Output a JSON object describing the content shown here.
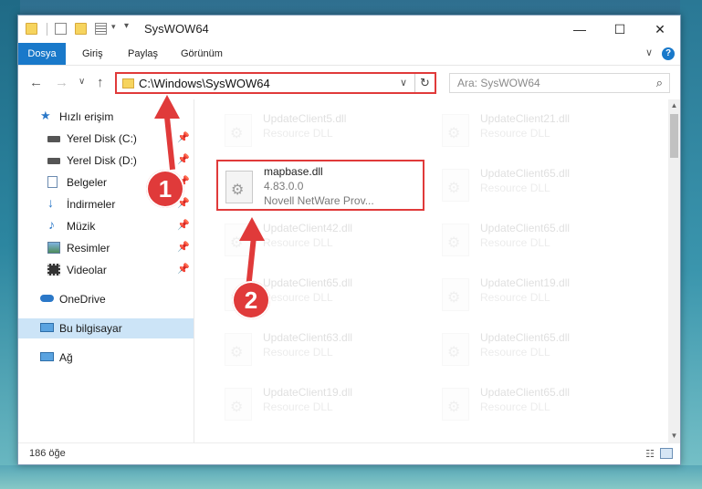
{
  "window": {
    "title": "SysWOW64",
    "minimize": "—",
    "maximize": "☐",
    "close": "✕"
  },
  "ribbon": {
    "tabs": [
      "Dosya",
      "Giriş",
      "Paylaş",
      "Görünüm"
    ],
    "help": "?"
  },
  "nav": {
    "back": "←",
    "forward": "→",
    "recent": "∨",
    "up": "↑",
    "address": "C:\\Windows\\SysWOW64",
    "refresh": "↻",
    "search_placeholder": "Ara: SysWOW64"
  },
  "sidebar": {
    "items": [
      {
        "label": "Hızlı erişim",
        "icon": "star-icon"
      },
      {
        "label": "Yerel Disk (C:)",
        "icon": "drive-icon"
      },
      {
        "label": "Yerel Disk (D:)",
        "icon": "drive-icon"
      },
      {
        "label": "Belgeler",
        "icon": "documents-icon"
      },
      {
        "label": "İndirmeler",
        "icon": "download-icon"
      },
      {
        "label": "Müzik",
        "icon": "music-icon"
      },
      {
        "label": "Resimler",
        "icon": "pictures-icon"
      },
      {
        "label": "Videolar",
        "icon": "videos-icon"
      },
      {
        "label": "OneDrive",
        "icon": "cloud-icon"
      },
      {
        "label": "Bu bilgisayar",
        "icon": "computer-icon"
      },
      {
        "label": "Ağ",
        "icon": "network-icon"
      }
    ]
  },
  "files": {
    "left": [
      {
        "name": "UpdateClient5.dll",
        "desc": "Resource DLL"
      },
      {
        "name": "mapbase.dll",
        "desc": "4.83.0.0",
        "desc2": "Novell NetWare Prov..."
      },
      {
        "name": "UpdateClient42.dll",
        "desc": "Resource DLL"
      },
      {
        "name": "UpdateClient65.dll",
        "desc": "Resource DLL"
      },
      {
        "name": "UpdateClient63.dll",
        "desc": "Resource DLL"
      },
      {
        "name": "UpdateClient19.dll",
        "desc": "Resource DLL"
      }
    ],
    "right": [
      {
        "name": "UpdateClient21.dll",
        "desc": "Resource DLL"
      },
      {
        "name": "UpdateClient65.dll",
        "desc": "Resource DLL"
      },
      {
        "name": "UpdateClient65.dll",
        "desc": "Resource DLL"
      },
      {
        "name": "UpdateClient19.dll",
        "desc": "Resource DLL"
      },
      {
        "name": "UpdateClient65.dll",
        "desc": "Resource DLL"
      },
      {
        "name": "UpdateClient65.dll",
        "desc": "Resource DLL"
      }
    ]
  },
  "status": {
    "count": "186 öğe"
  },
  "annotations": {
    "step1": "1",
    "step2": "2",
    "color": "#e03a3a"
  }
}
